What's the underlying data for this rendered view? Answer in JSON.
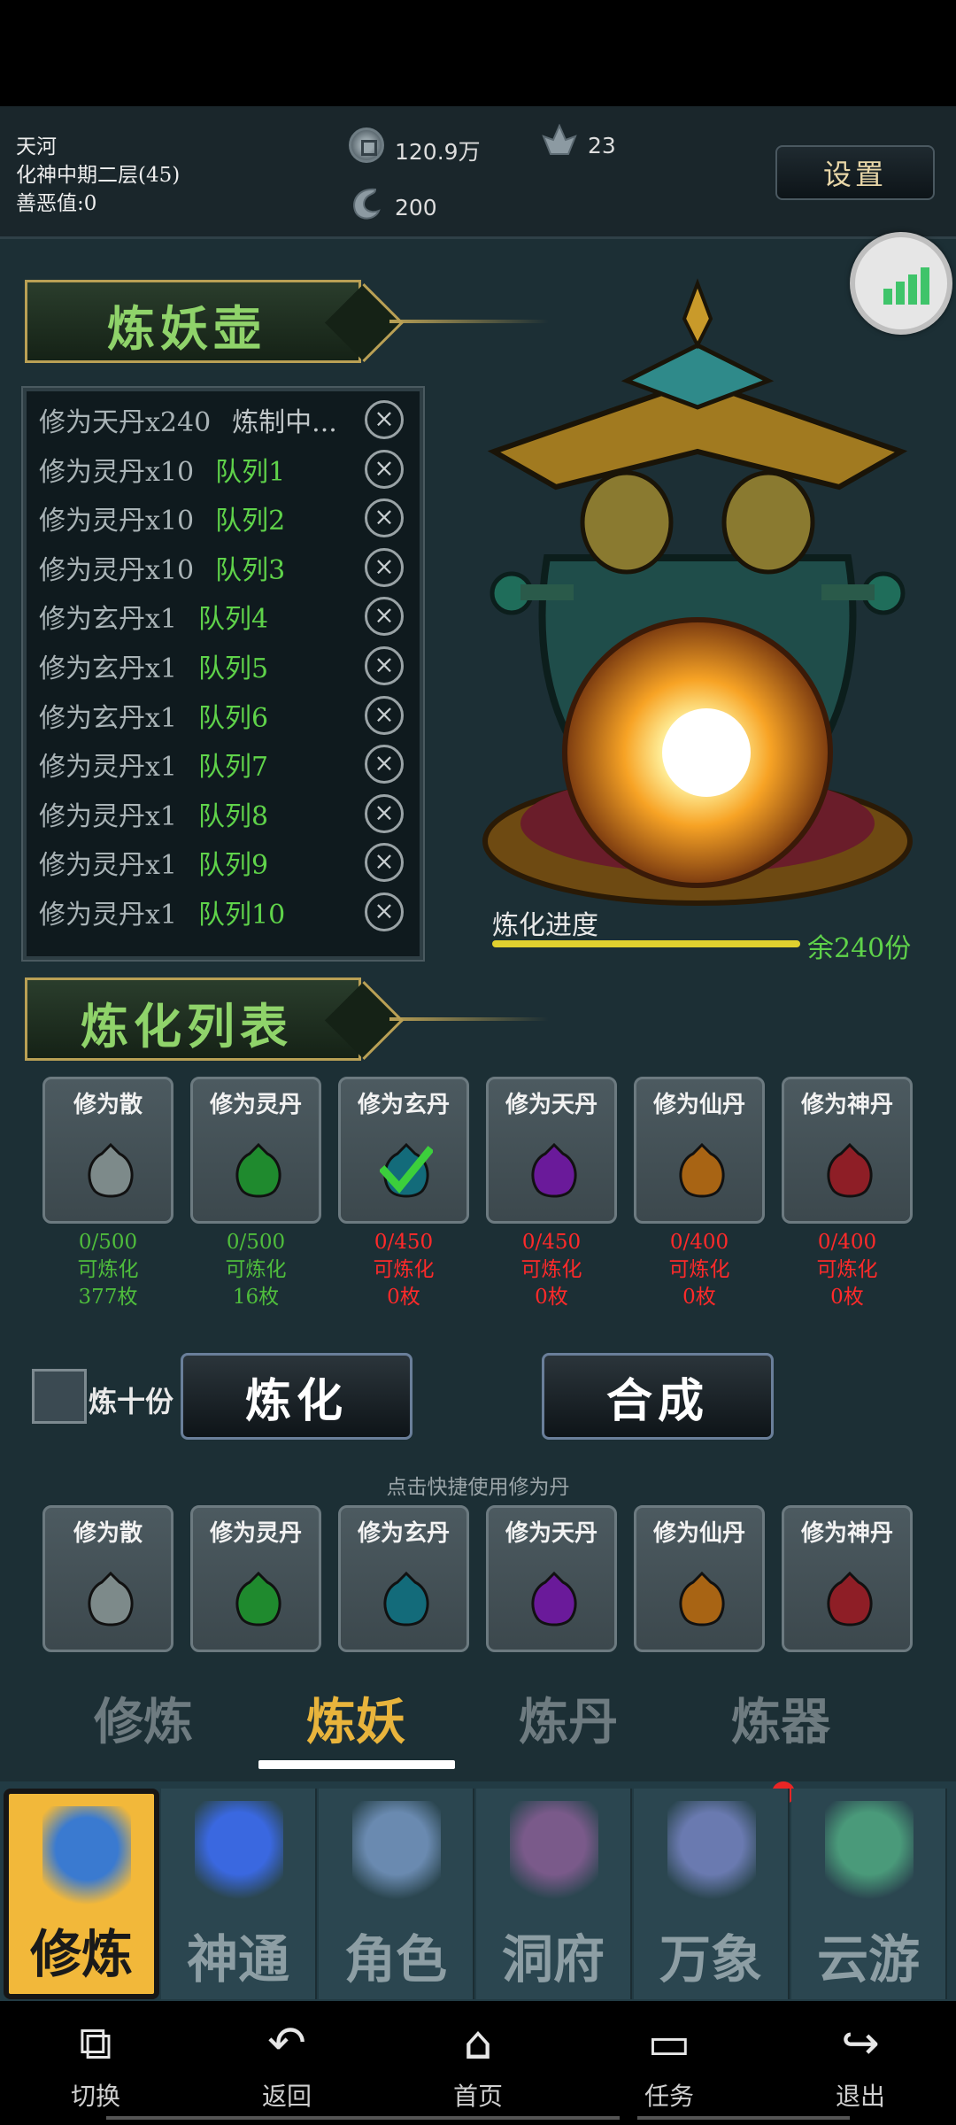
{
  "header": {
    "name": "天河",
    "realm": "化神中期二层(45)",
    "karma": "善恶值:0",
    "coins": "120.9万",
    "crystals": "23",
    "spirit": "200",
    "settings_label": "设置"
  },
  "refine_pot": {
    "title": "炼妖壶",
    "queue": [
      {
        "name": "修为天丹x240",
        "status": "炼制中..."
      },
      {
        "name": "修为灵丹x10",
        "status": "队列1"
      },
      {
        "name": "修为灵丹x10",
        "status": "队列2"
      },
      {
        "name": "修为灵丹x10",
        "status": "队列3"
      },
      {
        "name": "修为玄丹x1",
        "status": "队列4"
      },
      {
        "name": "修为玄丹x1",
        "status": "队列5"
      },
      {
        "name": "修为玄丹x1",
        "status": "队列6"
      },
      {
        "name": "修为灵丹x1",
        "status": "队列7"
      },
      {
        "name": "修为灵丹x1",
        "status": "队列8"
      },
      {
        "name": "修为灵丹x1",
        "status": "队列9"
      },
      {
        "name": "修为灵丹x1",
        "status": "队列10"
      }
    ],
    "progress_label": "炼化进度",
    "remaining": "余240份",
    "progress": 1.0
  },
  "refine_list": {
    "title": "炼化列表",
    "items": [
      {
        "label": "修为散",
        "count": "0/500",
        "state": "可炼化",
        "amount": "377枚",
        "color": "#7d8a8a",
        "status": "green"
      },
      {
        "label": "修为灵丹",
        "count": "0/500",
        "state": "可炼化",
        "amount": "16枚",
        "color": "#1f8a2e",
        "status": "green"
      },
      {
        "label": "修为玄丹",
        "count": "0/450",
        "state": "可炼化",
        "amount": "0枚",
        "color": "#136b7a",
        "status": "red"
      },
      {
        "label": "修为天丹",
        "count": "0/450",
        "state": "可炼化",
        "amount": "0枚",
        "color": "#6a1a9a",
        "status": "red"
      },
      {
        "label": "修为仙丹",
        "count": "0/400",
        "state": "可炼化",
        "amount": "0枚",
        "color": "#a86414",
        "status": "red"
      },
      {
        "label": "修为神丹",
        "count": "0/400",
        "state": "可炼化",
        "amount": "0枚",
        "color": "#8e1e26",
        "status": "red"
      }
    ]
  },
  "actions": {
    "ten_label": "炼十份",
    "refine_label": "炼化",
    "combine_label": "合成",
    "quick_hint": "点击快捷使用修为丹"
  },
  "quick_items": [
    "修为散",
    "修为灵丹",
    "修为玄丹",
    "修为天丹",
    "修为仙丹",
    "修为神丹"
  ],
  "sub_tabs": [
    "修炼",
    "炼妖",
    "炼丹",
    "炼器"
  ],
  "menu": [
    "修炼",
    "神通",
    "角色",
    "洞府",
    "万象",
    "云游"
  ],
  "nav": [
    "切换",
    "返回",
    "首页",
    "任务",
    "退出"
  ],
  "colors": {
    "accent_green": "#5fd34a",
    "gold": "#e8b43c",
    "red": "#ff2a2a"
  }
}
